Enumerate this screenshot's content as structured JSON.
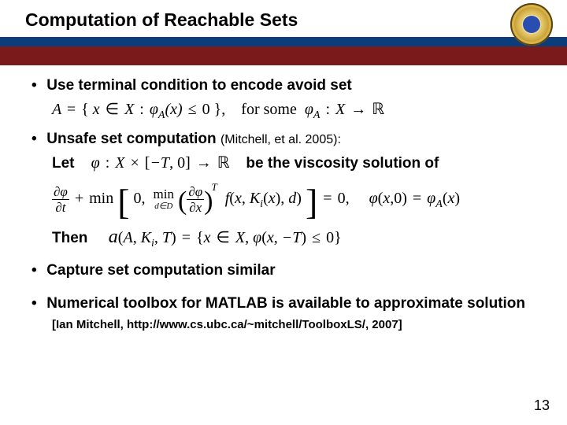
{
  "header": {
    "title": "Computation of Reachable Sets"
  },
  "bullets": {
    "b1": "Use terminal condition to encode avoid set",
    "b2_a": "Unsafe set computation ",
    "b2_ref": "(Mitchell, et al. 2005):",
    "b2_let": "Let",
    "b2_visc": "be the viscosity solution of",
    "b2_then": "Then",
    "b3": "Capture set computation similar",
    "b4": "Numerical toolbox for MATLAB is available to approximate solution",
    "cite": "[Ian Mitchell, http://www.cs.ubc.ca/~mitchell/ToolboxLS/, 2007]"
  },
  "math": {
    "avoid_set": "A = { x ∈ X : φ_A(x) ≤ 0 },   for some φ_A : X → ℝ",
    "phi_domain": "φ : X × [−T, 0] → ℝ",
    "hjb": "∂φ/∂t + min[ 0, min_{d∈D} (∂φ/∂x)^T f(x, K_i(x), d) ] = 0,   φ(x,0) = φ_A(x)",
    "result": "𝒜(A, K_i, T) = { x ∈ X, φ(x, −T) ≤ 0 }"
  },
  "page_number": "13"
}
